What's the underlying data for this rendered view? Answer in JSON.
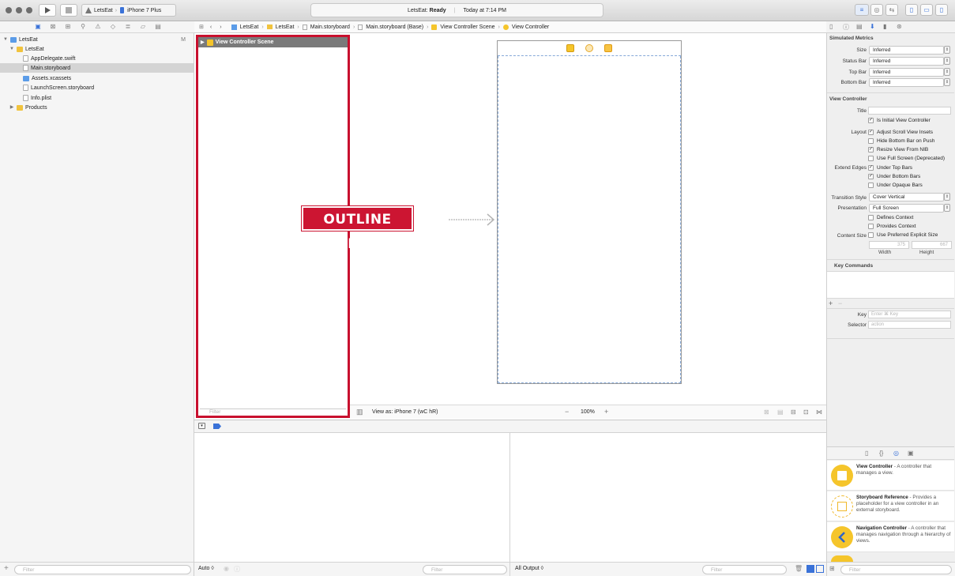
{
  "toolbar": {
    "scheme_target": "LetsEat",
    "scheme_device": "iPhone 7 Plus",
    "status_project": "LetsEat:",
    "status_state": "Ready",
    "status_time": "Today at 7:14 PM"
  },
  "navigator": {
    "tree": [
      {
        "label": "LetsEat",
        "badge": "M"
      },
      {
        "label": "LetsEat"
      },
      {
        "label": "AppDelegate.swift"
      },
      {
        "label": "Main.storyboard"
      },
      {
        "label": "Assets.xcassets"
      },
      {
        "label": "LaunchScreen.storyboard"
      },
      {
        "label": "Info.plist"
      },
      {
        "label": "Products"
      }
    ],
    "filter_placeholder": "Filter"
  },
  "jumpbar": {
    "crumbs": [
      "LetsEat",
      "LetsEat",
      "Main.storyboard",
      "Main.storyboard (Base)",
      "View Controller Scene",
      "View Controller"
    ]
  },
  "outline": {
    "scene_label": "View Controller Scene",
    "filter_placeholder": "Filter",
    "annotation": "OUTLINE VIEW"
  },
  "canvas_bar": {
    "view_as": "View as: iPhone 7 (wC hR)",
    "zoom_minus": "−",
    "zoom": "100%",
    "zoom_plus": "+"
  },
  "debug": {
    "auto_label": "Auto ◊",
    "output_label": "All Output ◊",
    "filter_placeholder": "Filter"
  },
  "inspector": {
    "simulated_metrics": {
      "title": "Simulated Metrics",
      "fields": [
        {
          "label": "Size",
          "value": "Inferred"
        },
        {
          "label": "Status Bar",
          "value": "Inferred"
        },
        {
          "label": "Top Bar",
          "value": "Inferred"
        },
        {
          "label": "Bottom Bar",
          "value": "Inferred"
        }
      ]
    },
    "view_controller": {
      "title": "View Controller",
      "title_label": "Title",
      "initial_vc": "Is Initial View Controller",
      "layout_label": "Layout",
      "layout_options": [
        {
          "label": "Adjust Scroll View Insets",
          "checked": true
        },
        {
          "label": "Hide Bottom Bar on Push",
          "checked": false
        },
        {
          "label": "Resize View From NIB",
          "checked": true
        },
        {
          "label": "Use Full Screen (Deprecated)",
          "checked": false
        }
      ],
      "extend_label": "Extend Edges",
      "extend_options": [
        {
          "label": "Under Top Bars",
          "checked": true
        },
        {
          "label": "Under Bottom Bars",
          "checked": true
        },
        {
          "label": "Under Opaque Bars",
          "checked": false
        }
      ],
      "transition_label": "Transition Style",
      "transition_value": "Cover Vertical",
      "presentation_label": "Presentation",
      "presentation_value": "Full Screen",
      "context_options": [
        {
          "label": "Defines Context",
          "checked": false
        },
        {
          "label": "Provides Context",
          "checked": false
        }
      ],
      "content_size_label": "Content Size",
      "content_size_option": "Use Preferred Explicit Size",
      "width_value": "375",
      "height_value": "667",
      "width_label": "Width",
      "height_label": "Height"
    },
    "key_commands": {
      "title": "Key Commands",
      "key_label": "Key",
      "key_placeholder": "Enter ⌘ Key",
      "selector_label": "Selector",
      "selector_placeholder": "action"
    }
  },
  "library": {
    "items": [
      {
        "title": "View Controller",
        "desc": " - A controller that manages a view."
      },
      {
        "title": "Storyboard Reference",
        "desc": " - Provides a placeholder for a view controller in an external storyboard."
      },
      {
        "title": "Navigation Controller",
        "desc": " - A controller that manages navigation through a hierarchy of views."
      }
    ],
    "filter_placeholder": "Filter"
  },
  "colors": {
    "annotation_red": "#cc1532",
    "library_yellow": "#f5c52b",
    "selection_blue": "#3a72d8"
  }
}
